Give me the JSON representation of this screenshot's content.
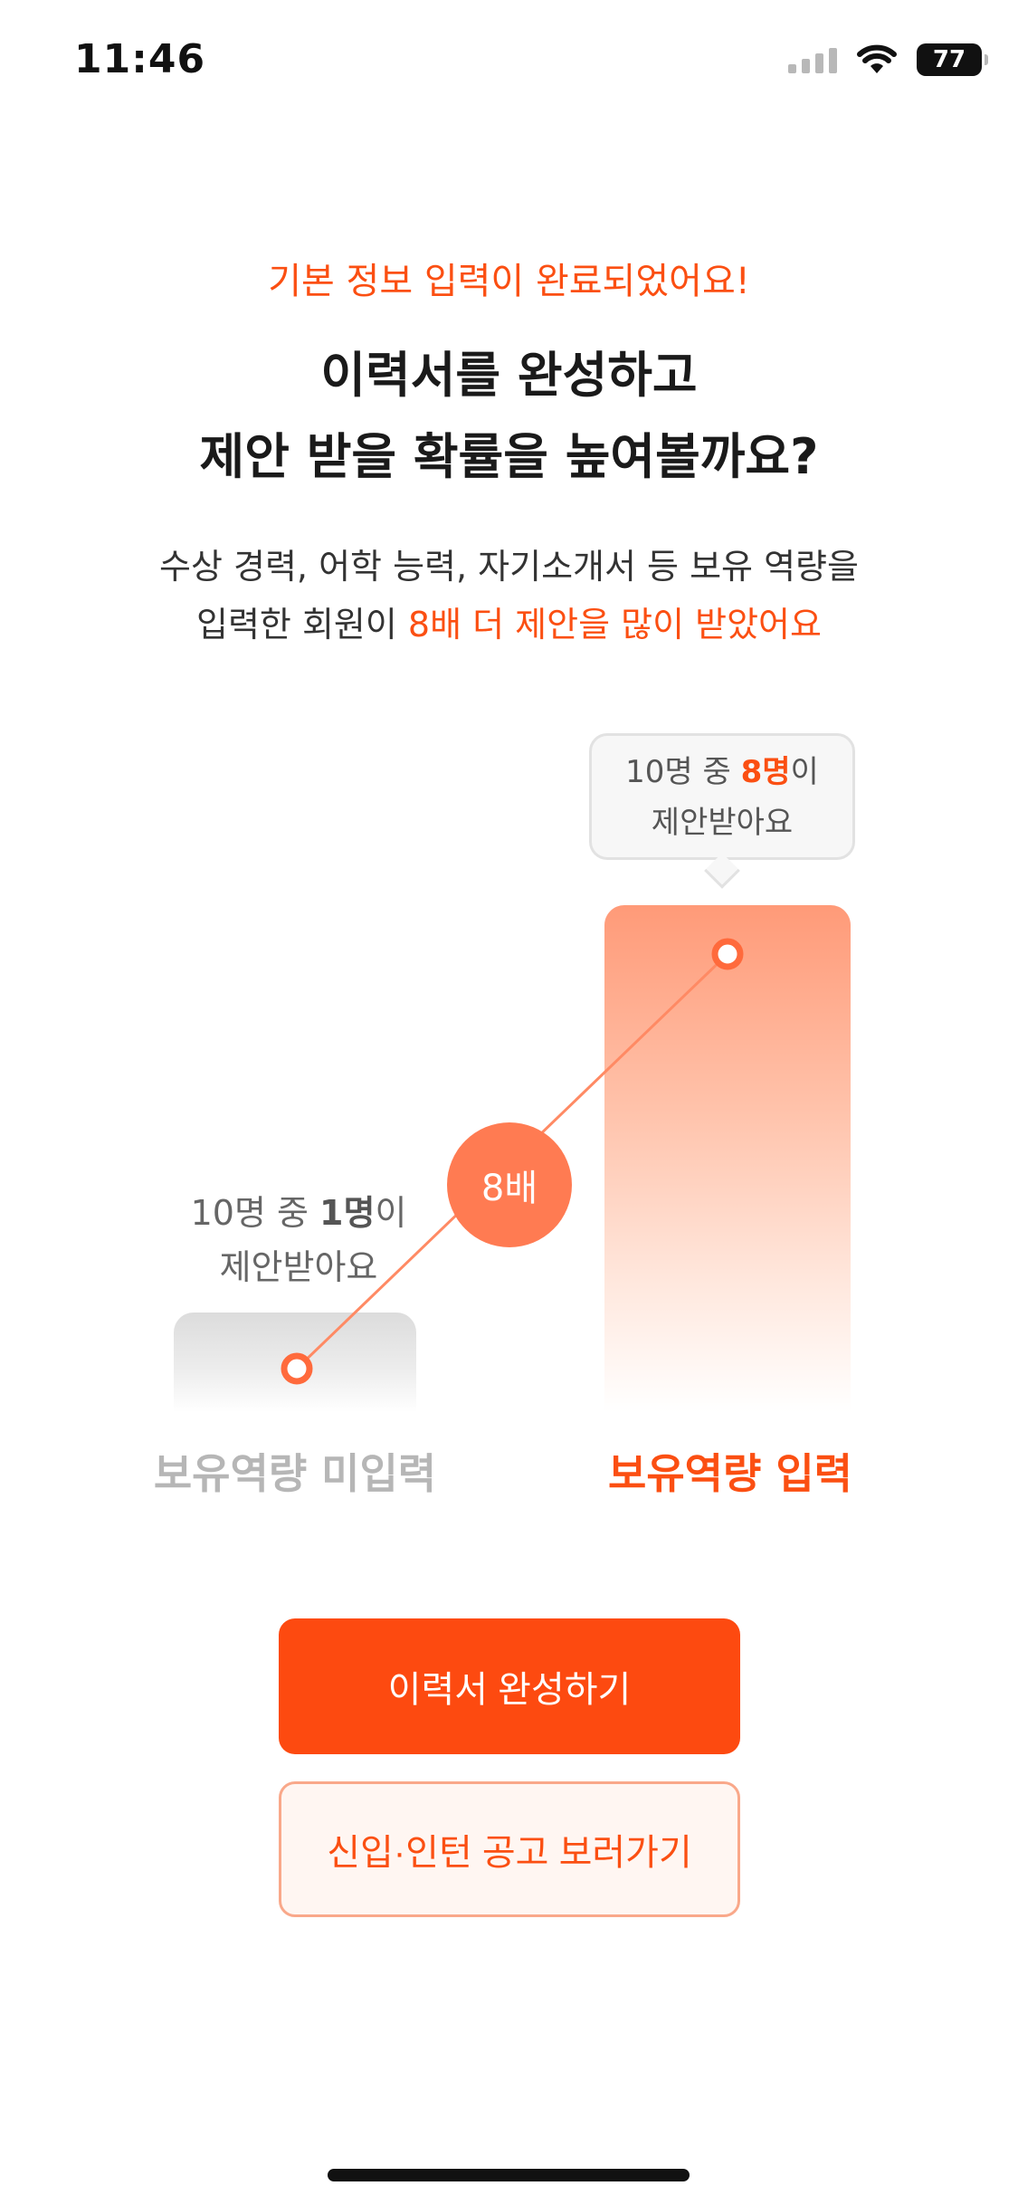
{
  "status_bar": {
    "time": "11:46",
    "battery": "77",
    "icons": [
      "signal-icon",
      "wifi-icon",
      "battery-icon"
    ]
  },
  "header": {
    "subtitle": "기본 정보 입력이 완료되었어요!",
    "headline_line1": "이력서를 완성하고",
    "headline_line2": "제안 받을 확률을 높여볼까요?"
  },
  "description": {
    "line1": "수상 경력, 어학 능력, 자기소개서 등 보유 역량을",
    "line2_prefix": "입력한 회원이 ",
    "line2_accent": "8배 더 제안을 많이 받았어요"
  },
  "comparison": {
    "right_bubble": {
      "prefix": "10명 중 ",
      "bold": "8명",
      "suffix": "이",
      "line2": "제안받아요"
    },
    "left_label": {
      "prefix": "10명 중 ",
      "bold": "1명",
      "suffix": "이",
      "line2": "제안받아요"
    },
    "multiplier": "8배",
    "left_category": "보유역량 미입력",
    "right_category": "보유역량 입력"
  },
  "buttons": {
    "primary": "이력서 완성하기",
    "secondary": "신입·인턴 공고 보러가기"
  },
  "colors": {
    "accent": "#fb4f12",
    "primary_button": "#fd4a10",
    "multiplier_circle": "#ff7b52",
    "muted": "#b6b6b6"
  }
}
